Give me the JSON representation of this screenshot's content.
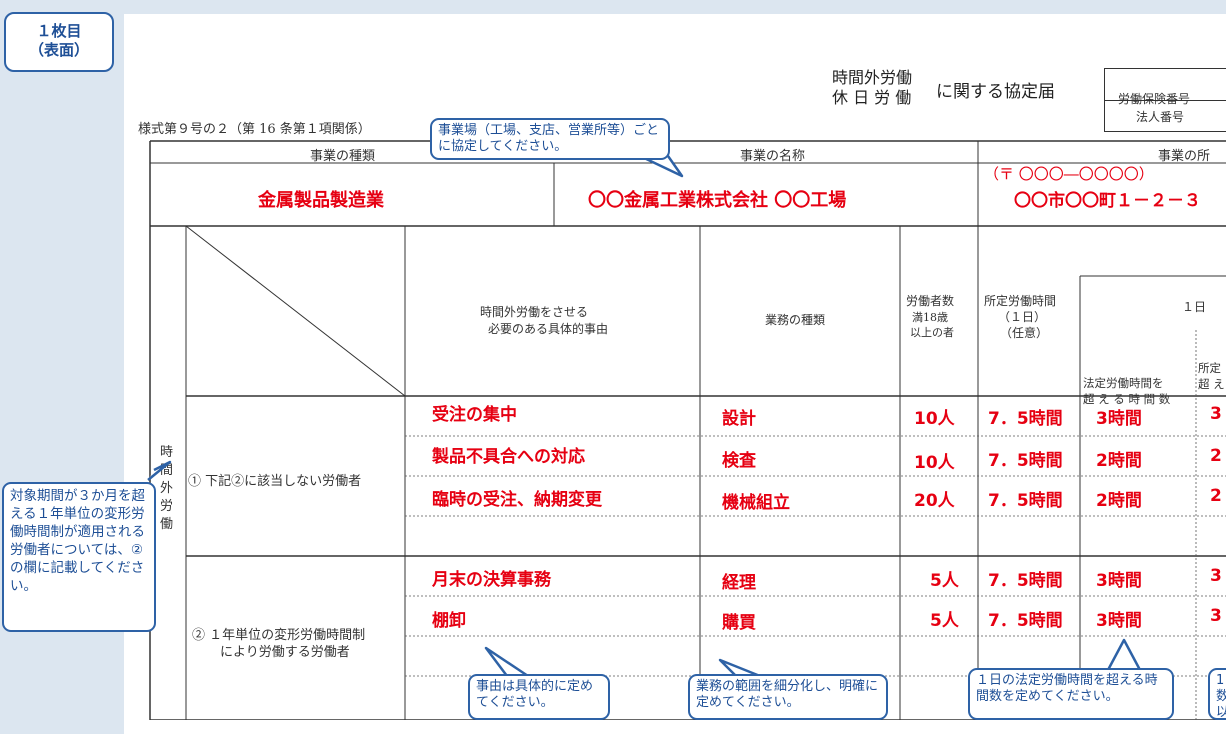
{
  "badge": {
    "line1": "１枚目",
    "line2": "（表面）"
  },
  "header": {
    "title_top": "時間外労働",
    "title_bottom": "休 日 労 働",
    "title_suffix": "に関する協定届",
    "form_number": "様式第９号の２（第 16 条第１項関係）",
    "insurance_label": "労働保険番号",
    "corp_label": "法人番号"
  },
  "table": {
    "col_business_type": "事業の種類",
    "col_business_name": "事業の名称",
    "col_business_address": "事業の所",
    "business_type": "金属製品製造業",
    "business_name": "〇〇金属工業株式会社 〇〇工場",
    "postal": "（〒 〇〇〇―〇〇〇〇）",
    "address": "〇〇市〇〇町１－２－３",
    "col_reason": "時間外労働をさせる\n必要のある具体的事由",
    "col_reason_l1": "時間外労働をさせる",
    "col_reason_l2": "必要のある具体的事由",
    "col_work_type": "業務の種類",
    "col_workers_l1": "労働者数",
    "col_workers_l2": "満18歳",
    "col_workers_l3": "以上の者",
    "col_prescribed_l1": "所定労働時間",
    "col_prescribed_l2": "（１日）",
    "col_prescribed_l3": "（任意）",
    "col_day": "１日",
    "col_legal_l1": "法定労働時間を",
    "col_legal_l2": "超 え る 時 間 数",
    "col_sched_l1": "所定",
    "col_sched_l2": "超 え",
    "side_label": "時間外労働",
    "group1_label": "① 下記②に該当しない労働者",
    "group2_label_l1": "② １年単位の変形労働時間制",
    "group2_label_l2": "により労働する労働者",
    "rows": [
      {
        "reason": "受注の集中",
        "work": "設計",
        "count": "10人",
        "prescribed": "7．5時間",
        "legal": "3時間",
        "sched": "3"
      },
      {
        "reason": "製品不具合への対応",
        "work": "検査",
        "count": "10人",
        "prescribed": "7．5時間",
        "legal": "2時間",
        "sched": "2"
      },
      {
        "reason": "臨時の受注、納期変更",
        "work": "機械組立",
        "count": "20人",
        "prescribed": "7．5時間",
        "legal": "2時間",
        "sched": "2"
      },
      {
        "reason": "月末の決算事務",
        "work": "経理",
        "count": "5人",
        "prescribed": "7．5時間",
        "legal": "3時間",
        "sched": "3"
      },
      {
        "reason": "棚卸",
        "work": "購買",
        "count": "5人",
        "prescribed": "7．5時間",
        "legal": "3時間",
        "sched": "3"
      }
    ]
  },
  "callouts": {
    "per_site": "事業場（工場、支店、営業所等）ごとに協定してください。",
    "period": "対象期間が３か月を超える１年単位の変形労働時間制が適用される労働者については、②の欄に記載してください。",
    "reason": "事由は具体的に定めてください。",
    "work_scope": "業務の範囲を細分化し、明確に定めてください。",
    "legal_hours": "１日の法定労働時間を超える時間数を定めてください。",
    "right_partial": "1\n数\n以"
  },
  "colors": {
    "accent": "#2e62a6",
    "red": "#e60012",
    "bg": "#dce6f0"
  }
}
